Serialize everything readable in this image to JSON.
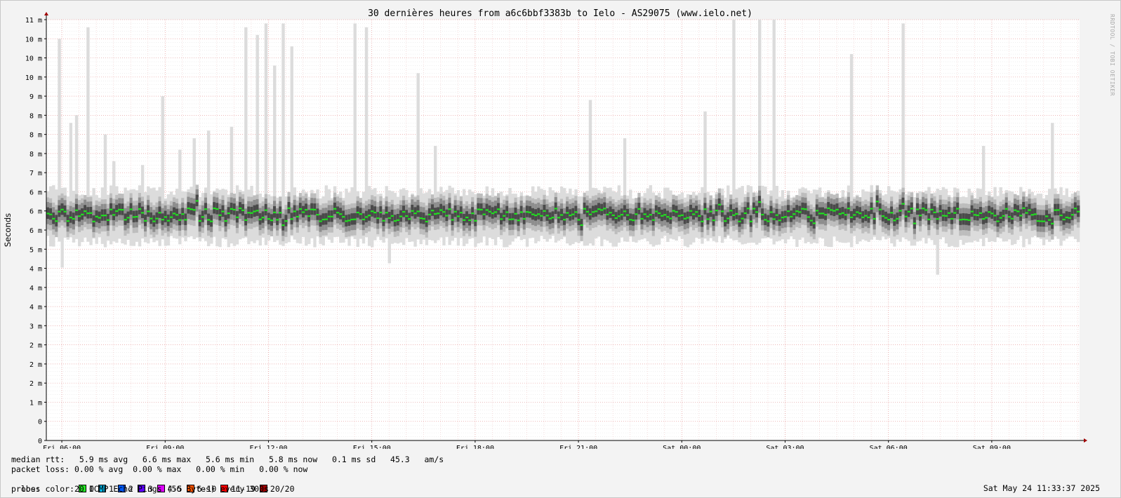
{
  "title": "30 dernières heures from a6c6bbf3383b to Ielo - AS29075 (www.ielo.net)",
  "side_label": "RRDTOOL / TOBI OETIKER",
  "chart_data": {
    "type": "line",
    "ylabel": "Seconds",
    "ylim": [
      0,
      0.011
    ],
    "y_ticks": [
      {
        "value": 0,
        "label": "0"
      },
      {
        "value": 0.0005,
        "label": "0"
      },
      {
        "value": 0.001,
        "label": "1 m"
      },
      {
        "value": 0.0015,
        "label": "2 m"
      },
      {
        "value": 0.002,
        "label": "2 m"
      },
      {
        "value": 0.0025,
        "label": "2 m"
      },
      {
        "value": 0.003,
        "label": "3 m"
      },
      {
        "value": 0.0035,
        "label": "4 m"
      },
      {
        "value": 0.004,
        "label": "4 m"
      },
      {
        "value": 0.0045,
        "label": "4 m"
      },
      {
        "value": 0.005,
        "label": "5 m"
      },
      {
        "value": 0.0055,
        "label": "6 m"
      },
      {
        "value": 0.006,
        "label": "6 m"
      },
      {
        "value": 0.0065,
        "label": "6 m"
      },
      {
        "value": 0.007,
        "label": "7 m"
      },
      {
        "value": 0.0075,
        "label": "8 m"
      },
      {
        "value": 0.008,
        "label": "8 m"
      },
      {
        "value": 0.0085,
        "label": "8 m"
      },
      {
        "value": 0.009,
        "label": "9 m"
      },
      {
        "value": 0.0095,
        "label": "10 m"
      },
      {
        "value": 0.01,
        "label": "10 m"
      },
      {
        "value": 0.0105,
        "label": "10 m"
      },
      {
        "value": 0.011,
        "label": "11 m"
      }
    ],
    "x_ticks": [
      "Fri 06:00",
      "Fri 09:00",
      "Fri 12:00",
      "Fri 15:00",
      "Fri 18:00",
      "Fri 21:00",
      "Sat 00:00",
      "Sat 03:00",
      "Sat 06:00",
      "Sat 09:00"
    ],
    "x_range_hours": [
      5.55,
      35.55
    ],
    "series": [
      {
        "name": "median rtt",
        "color": "#20e020"
      }
    ],
    "median_rtt_ms": {
      "avg": 5.9,
      "max": 6.6,
      "min": 5.6,
      "now": 5.8,
      "sd": 0.1
    },
    "smoke_band_ms": {
      "typical_low": 5.2,
      "typical_high": 6.5
    },
    "spikes": [
      {
        "hour": 5.9,
        "max_ms": 10.5
      },
      {
        "hour": 6.2,
        "max_ms": 8.3
      },
      {
        "hour": 6.4,
        "max_ms": 8.5
      },
      {
        "hour": 6.7,
        "max_ms": 10.8
      },
      {
        "hour": 7.2,
        "max_ms": 8.0
      },
      {
        "hour": 7.5,
        "max_ms": 7.3
      },
      {
        "hour": 8.3,
        "max_ms": 7.2
      },
      {
        "hour": 8.9,
        "max_ms": 9.0
      },
      {
        "hour": 9.4,
        "max_ms": 7.6
      },
      {
        "hour": 9.8,
        "max_ms": 7.9
      },
      {
        "hour": 10.2,
        "max_ms": 8.1
      },
      {
        "hour": 10.9,
        "max_ms": 8.2
      },
      {
        "hour": 11.3,
        "max_ms": 10.8
      },
      {
        "hour": 11.6,
        "max_ms": 10.6
      },
      {
        "hour": 11.9,
        "max_ms": 10.9
      },
      {
        "hour": 12.1,
        "max_ms": 9.8
      },
      {
        "hour": 12.4,
        "max_ms": 10.9
      },
      {
        "hour": 12.6,
        "max_ms": 10.3
      },
      {
        "hour": 14.5,
        "max_ms": 10.9
      },
      {
        "hour": 14.8,
        "max_ms": 10.8
      },
      {
        "hour": 16.3,
        "max_ms": 9.6
      },
      {
        "hour": 16.8,
        "max_ms": 7.7
      },
      {
        "hour": 21.3,
        "max_ms": 8.9
      },
      {
        "hour": 22.3,
        "max_ms": 7.9
      },
      {
        "hour": 24.6,
        "max_ms": 8.6
      },
      {
        "hour": 25.5,
        "max_ms": 11.0
      },
      {
        "hour": 26.2,
        "max_ms": 11.0
      },
      {
        "hour": 26.6,
        "max_ms": 11.0
      },
      {
        "hour": 28.9,
        "max_ms": 10.1
      },
      {
        "hour": 30.4,
        "max_ms": 10.9
      },
      {
        "hour": 32.7,
        "max_ms": 7.7
      },
      {
        "hour": 34.7,
        "max_ms": 8.3
      }
    ]
  },
  "legend": {
    "median_rtt": "median rtt:   5.9 ms avg   6.6 ms max   5.6 ms min   5.8 ms now   0.1 ms sd   45.3   am/s",
    "packet_loss": "packet loss: 0.00 % avg  0.00 % max   0.00 % min   0.00 % now",
    "loss_color_label": "loss color:",
    "loss_colors": [
      {
        "label": "0",
        "color": "#26ec26"
      },
      {
        "label": "1",
        "color": "#00b8ec"
      },
      {
        "label": "2",
        "color": "#0059ff"
      },
      {
        "label": "3",
        "color": "#5e00ff"
      },
      {
        "label": "4-5",
        "color": "#dd00ff"
      },
      {
        "label": "6-10",
        "color": "#ff5500"
      },
      {
        "label": "11-19",
        "color": "#ff0000"
      },
      {
        "label": "20/20",
        "color": "#a10000"
      }
    ],
    "probe": "probe:       20 ICMP Echo Pings (56 Bytes) every 300s",
    "timestamp": "Sat May 24 11:33:37 2025"
  }
}
